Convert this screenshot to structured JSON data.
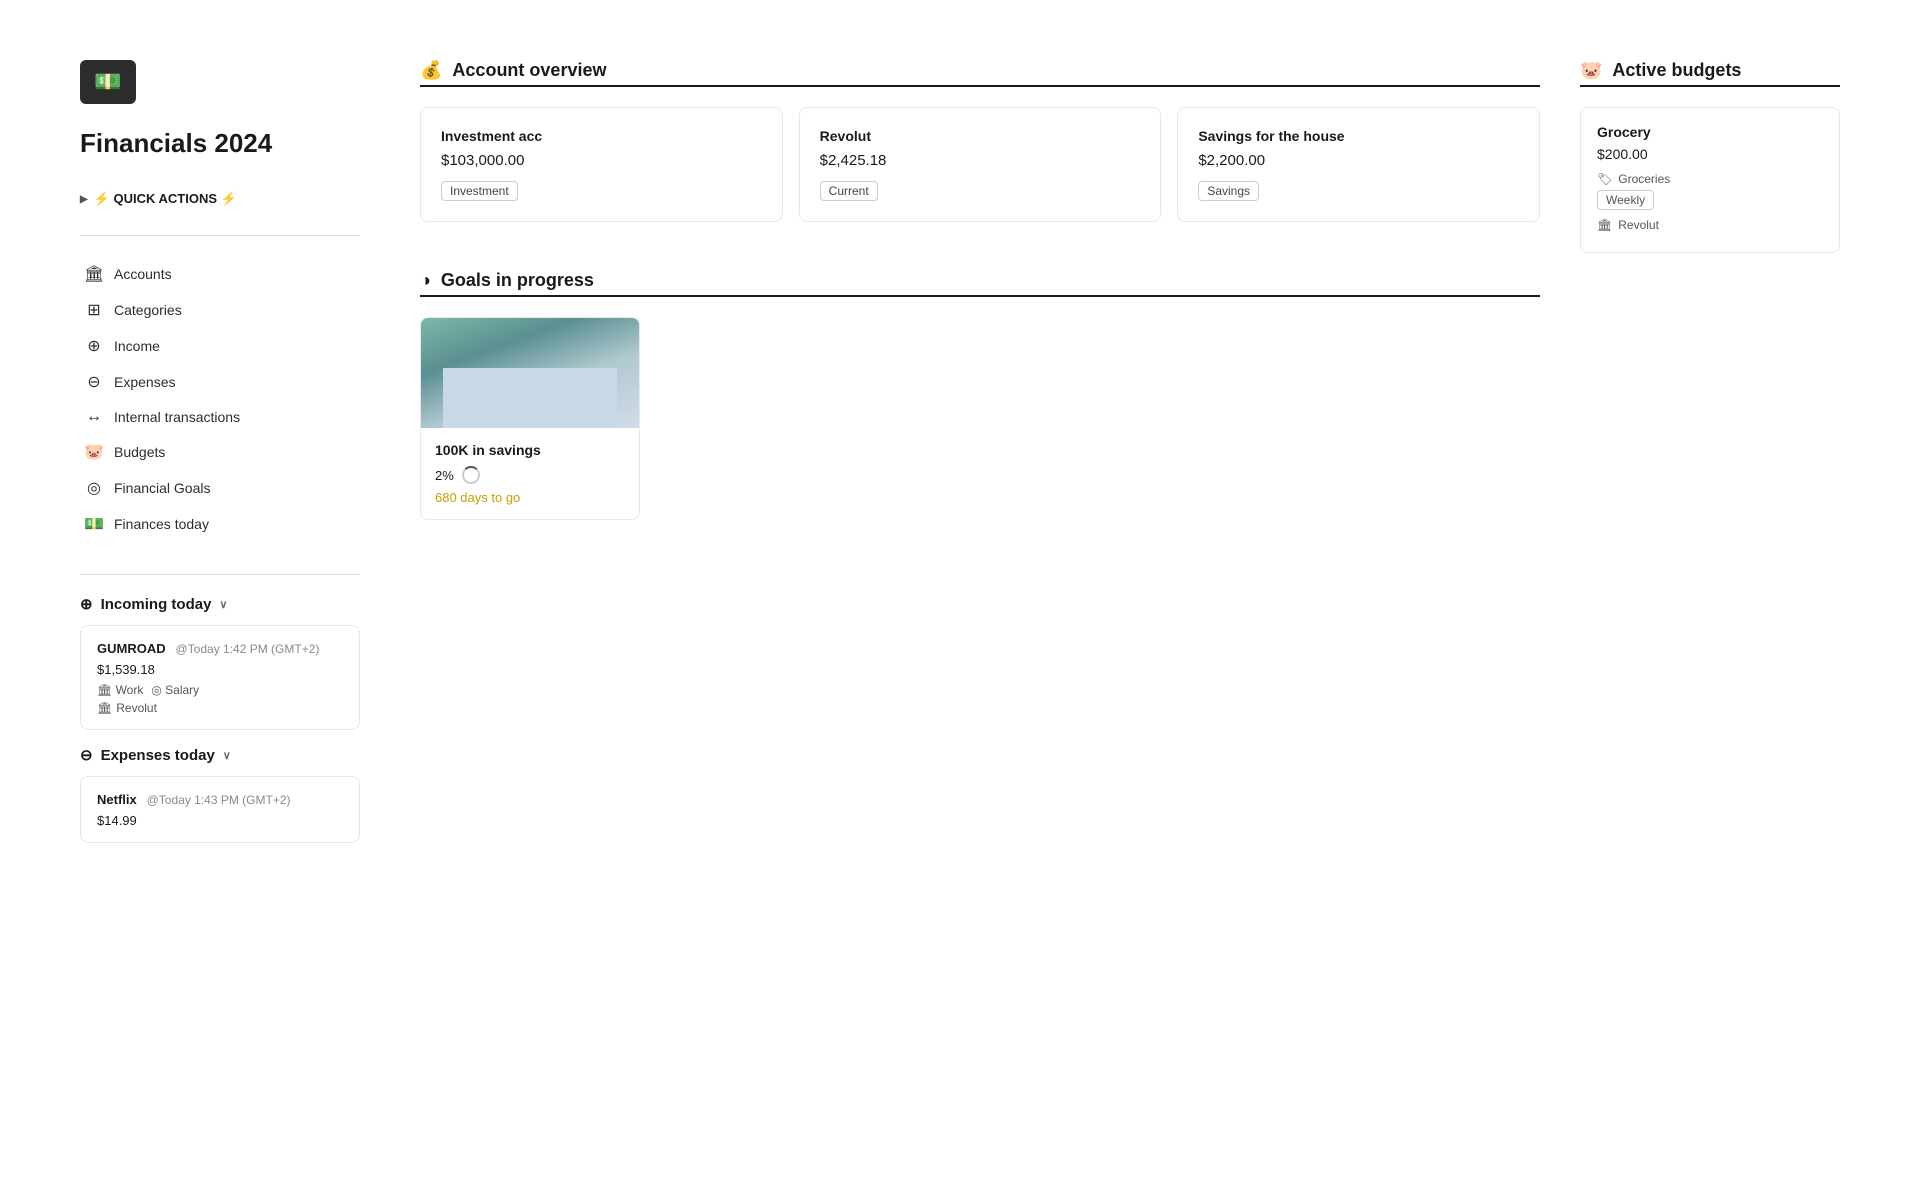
{
  "app": {
    "title": "Financials 2024",
    "logo_icon": "💵"
  },
  "sidebar": {
    "quick_actions_label": "⚡ QUICK ACTIONS ⚡",
    "nav_items": [
      {
        "label": "Accounts",
        "icon": "🏛"
      },
      {
        "label": "Categories",
        "icon": "⊞"
      },
      {
        "label": "Income",
        "icon": "⊕"
      },
      {
        "label": "Expenses",
        "icon": "⊖"
      },
      {
        "label": "Internal transactions",
        "icon": "↔"
      },
      {
        "label": "Budgets",
        "icon": "🐷"
      },
      {
        "label": "Financial Goals",
        "icon": "◎"
      },
      {
        "label": "Finances today",
        "icon": "💵"
      }
    ],
    "incoming_today_label": "Incoming today",
    "expenses_today_label": "Expenses today",
    "incoming_transactions": [
      {
        "name": "GUMROAD",
        "date": "@Today 1:42 PM (GMT+2)",
        "amount": "$1,539.18",
        "tags": [
          "Work",
          "Salary"
        ],
        "account": "Revolut"
      }
    ],
    "expenses_transactions": [
      {
        "name": "Netflix",
        "date": "@Today 1:43 PM (GMT+2)",
        "amount": "$14.99"
      }
    ]
  },
  "account_overview": {
    "section_label": "Account overview",
    "section_icon": "💰",
    "accounts": [
      {
        "name": "Investment acc",
        "amount": "$103,000.00",
        "type": "Investment"
      },
      {
        "name": "Revolut",
        "amount": "$2,425.18",
        "type": "Current"
      },
      {
        "name": "Savings for the house",
        "amount": "$2,200.00",
        "type": "Savings"
      }
    ]
  },
  "active_budgets": {
    "section_label": "Active budgets",
    "section_icon": "🐷",
    "budgets": [
      {
        "name": "Grocery",
        "amount": "$200.00",
        "category": "Groceries",
        "frequency": "Weekly",
        "account": "Revolut"
      }
    ]
  },
  "goals": {
    "section_label": "Goals in progress",
    "section_icon": "◑",
    "items": [
      {
        "name": "100K in savings",
        "progress_pct": "2%",
        "days_left": "680 days to go"
      }
    ]
  }
}
